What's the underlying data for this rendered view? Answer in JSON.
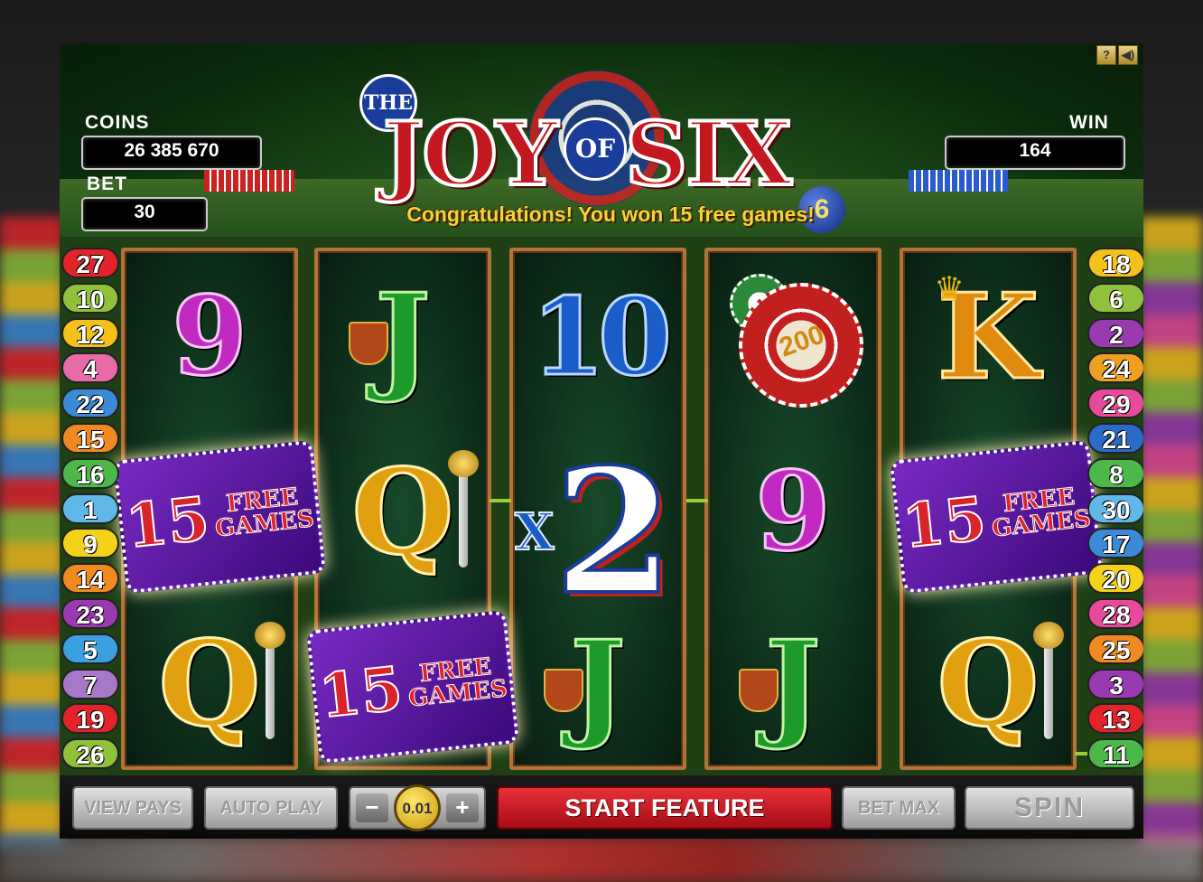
{
  "game": {
    "title_parts": [
      "THE",
      "JOY",
      "OF",
      "SIX",
      "6"
    ],
    "message": "Congratulations! You won 15 free games!"
  },
  "meters": {
    "coins_label": "COINS",
    "coins_value": "26 385 670",
    "bet_label": "BET",
    "bet_value": "30",
    "win_label": "WIN",
    "win_value": "164"
  },
  "top_icons": [
    "help-icon",
    "sound-icon"
  ],
  "top_icon_glyphs": [
    "?",
    "◀)"
  ],
  "reels": [
    [
      "9",
      "15 FREE GAMES",
      "Q"
    ],
    [
      "J",
      "Q",
      "15 FREE GAMES"
    ],
    [
      "10",
      "x2",
      "J"
    ],
    [
      "200 chips",
      "9",
      "J"
    ],
    [
      "K",
      "15 FREE GAMES",
      "Q"
    ]
  ],
  "free_card": {
    "number": "15",
    "line1": "FREE",
    "line2": "GAMES"
  },
  "chip_value": "200",
  "multiplier": {
    "x": "X",
    "value": "2"
  },
  "paylines": {
    "left": [
      {
        "n": "27",
        "color": "#e2242a"
      },
      {
        "n": "10",
        "color": "#8fc23a"
      },
      {
        "n": "12",
        "color": "#f2c21a"
      },
      {
        "n": "4",
        "color": "#e86aa6"
      },
      {
        "n": "22",
        "color": "#3a8ad8"
      },
      {
        "n": "15",
        "color": "#f08a20"
      },
      {
        "n": "16",
        "color": "#4cb84a"
      },
      {
        "n": "1",
        "color": "#5fb8e8"
      },
      {
        "n": "9",
        "color": "#f4d21a"
      },
      {
        "n": "14",
        "color": "#f08a20"
      },
      {
        "n": "23",
        "color": "#9a3ab0"
      },
      {
        "n": "5",
        "color": "#3aa0e0"
      },
      {
        "n": "7",
        "color": "#a878c8"
      },
      {
        "n": "19",
        "color": "#e2242a"
      },
      {
        "n": "26",
        "color": "#8fc23a"
      }
    ],
    "right": [
      {
        "n": "18",
        "color": "#f2c21a"
      },
      {
        "n": "6",
        "color": "#8fc23a"
      },
      {
        "n": "2",
        "color": "#9a3ab0"
      },
      {
        "n": "24",
        "color": "#f0a020"
      },
      {
        "n": "29",
        "color": "#e84a9a"
      },
      {
        "n": "21",
        "color": "#2a6ac8"
      },
      {
        "n": "8",
        "color": "#4cb84a"
      },
      {
        "n": "30",
        "color": "#5fb8e8"
      },
      {
        "n": "17",
        "color": "#3a8ad8"
      },
      {
        "n": "20",
        "color": "#f4d21a"
      },
      {
        "n": "28",
        "color": "#e84a9a"
      },
      {
        "n": "25",
        "color": "#f08a20"
      },
      {
        "n": "3",
        "color": "#9a3ab0"
      },
      {
        "n": "13",
        "color": "#e2242a"
      },
      {
        "n": "11",
        "color": "#4cb84a"
      }
    ]
  },
  "controls": {
    "view_pays": "VIEW PAYS",
    "auto_play": "AUTO PLAY",
    "coin_minus": "−",
    "coin_value": "0.01",
    "coin_plus": "+",
    "start_feature": "START FEATURE",
    "bet_max": "BET MAX",
    "spin": "SPIN"
  },
  "colors": {
    "accent_red": "#c41820",
    "felt_green": "#1d4a18",
    "reel_frame": "#b0733a",
    "message_gold": "#f3d23a"
  }
}
